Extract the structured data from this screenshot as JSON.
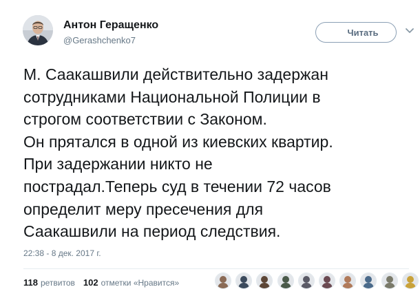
{
  "author": {
    "name": "Антон Геращенко",
    "handle": "@Gerashchenko7",
    "avatar_icon": "person-portrait"
  },
  "follow_button": {
    "label": "Читать",
    "color": "#5a6d80"
  },
  "menu_icon": "chevron-down-icon",
  "tweet": {
    "lines": [
      "М. Саакашвили действительно задержан",
      "сотрудниками Национальной Полиции в",
      "строгом соответствии с Законом.",
      "Он прятался в одной из киевских квартир.",
      "При задержании никто не",
      "пострадал.Теперь суд в течении 72 часов",
      "определит меру пресечения для",
      "Саакашвили на период следствия."
    ],
    "timestamp": "22:38 - 8 дек. 2017 г."
  },
  "stats": {
    "retweets": "118",
    "retweets_label": "ретвитов",
    "likes": "102",
    "likes_label": "отметки «Нравится»"
  },
  "likers": [
    {
      "color": "#8a6a55"
    },
    {
      "color": "#3b4a5c"
    },
    {
      "color": "#5c4636"
    },
    {
      "color": "#4a5a4a"
    },
    {
      "color": "#5a5a66"
    },
    {
      "color": "#6b4a52"
    },
    {
      "color": "#b07a5a"
    },
    {
      "color": "#4a6a8a"
    },
    {
      "color": "#7a7a6a"
    },
    {
      "color": "#c9a23a"
    }
  ]
}
